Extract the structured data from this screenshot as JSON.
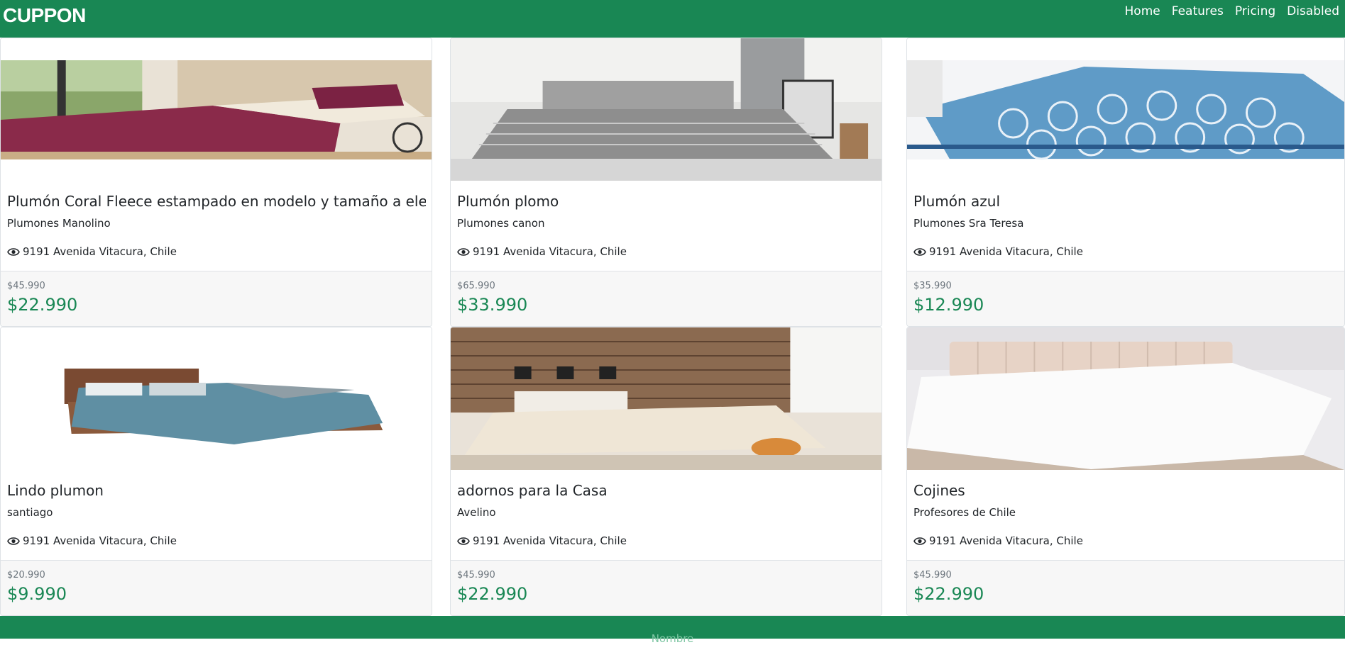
{
  "navbar": {
    "brand": "CUPPON",
    "links": [
      "Home",
      "Features",
      "Pricing",
      "Disabled"
    ]
  },
  "cards": [
    {
      "title": "Plumón Coral Fleece estampado en modelo y tamaño a elección",
      "store": "Plumones Manolino",
      "location": "9191 Avenida Vitacura, Chile",
      "old_price": "$45.990",
      "price": "$22.990",
      "image": "burgundy-comforter-bed"
    },
    {
      "title": "Plumón plomo",
      "store": "Plumones canon",
      "location": "9191 Avenida Vitacura, Chile",
      "old_price": "$65.990",
      "price": "$33.990",
      "image": "grey-bedroom"
    },
    {
      "title": "Plumón azul",
      "store": "Plumones Sra Teresa",
      "location": "9191 Avenida Vitacura, Chile",
      "old_price": "$35.990",
      "price": "$12.990",
      "image": "blue-pattern-comforter"
    },
    {
      "title": "Lindo plumon",
      "store": "santiago",
      "location": "9191 Avenida Vitacura, Chile",
      "old_price": "$20.990",
      "price": "$9.990",
      "image": "teal-comforter-bed"
    },
    {
      "title": "adornos para la Casa",
      "store": "Avelino",
      "location": "9191 Avenida Vitacura, Chile",
      "old_price": "$45.990",
      "price": "$22.990",
      "image": "wood-wall-bedroom"
    },
    {
      "title": "Cojines",
      "store": "Profesores de Chile",
      "location": "9191 Avenida Vitacura, Chile",
      "old_price": "$45.990",
      "price": "$22.990",
      "image": "white-quilted-bed"
    }
  ],
  "footer": {
    "text": "Nombre"
  },
  "colors": {
    "brand": "#198754",
    "price": "#198754",
    "muted": "#6c757d"
  }
}
